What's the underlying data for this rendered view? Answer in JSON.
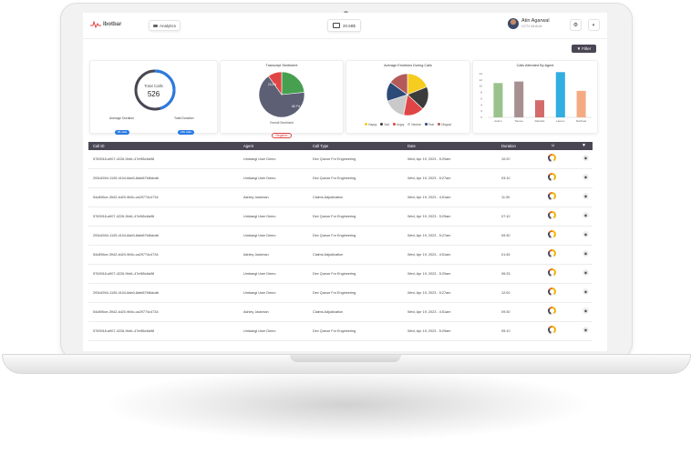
{
  "app": {
    "brand": "Ibotbar"
  },
  "header": {
    "section_label": "Analytics",
    "credits": "20.68$",
    "user_name": "Atin Agarwal",
    "user_sub": "CCTV 48 ALM",
    "filter_label": "Filter"
  },
  "cards": {
    "total_calls": {
      "label": "Total Calls",
      "value": "526",
      "avg_label": "Average Duration",
      "avg_value": "85 calls",
      "total_label": "Total Duration",
      "total_value": "180 calls"
    },
    "sentiment": {
      "title": "Transcript Sentiment",
      "slice_labels": [
        "23.4%",
        "66.7%"
      ],
      "overall_label": "Overall Sentiment",
      "overall_value": "Negative"
    },
    "emotions": {
      "title": "Average Emotions During Calls",
      "legend": [
        "Happy",
        "Sad",
        "Angry",
        "Neutral",
        "Fear",
        "Disgust"
      ]
    },
    "agent_calls": {
      "title": "Calls Attended By Agent",
      "y_ticks": [
        "14",
        "12",
        "10",
        "8",
        "6",
        "4",
        "2",
        "0"
      ],
      "agents": [
        "Action",
        "Tanvee",
        "Danielle",
        "Lauren",
        "Rachael"
      ]
    }
  },
  "chart_data": [
    {
      "type": "pie",
      "title": "Transcript Sentiment",
      "labels": [
        "Positive",
        "Negative",
        "Neutral"
      ],
      "values": [
        23.4,
        66.7,
        9.9
      ],
      "colors": [
        "#46a04f",
        "#5d5f74",
        "#e04545"
      ]
    },
    {
      "type": "pie",
      "title": "Average Emotions During Calls",
      "labels": [
        "Happy",
        "Sad",
        "Angry",
        "Neutral",
        "Fear",
        "Disgust"
      ],
      "values": [
        19,
        18,
        16,
        17,
        15,
        15
      ],
      "colors": [
        "#f5cc1f",
        "#3b3b3b",
        "#e04545",
        "#c9c9c9",
        "#2c4a78",
        "#b55a5a"
      ]
    },
    {
      "type": "bar",
      "title": "Calls Attended By Agent",
      "categories": [
        "Action",
        "Tanvee",
        "Danielle",
        "Lauren",
        "Rachael"
      ],
      "values": [
        11,
        11.5,
        5.5,
        14.5,
        8.5
      ],
      "colors": [
        "#9bc28c",
        "#a89090",
        "#d46b6b",
        "#32aee0",
        "#f4ab84"
      ],
      "ylim": [
        0,
        14
      ]
    }
  ],
  "table": {
    "columns": [
      "Call ID",
      "Agent",
      "Call Type",
      "Date",
      "Duration"
    ],
    "rows": [
      {
        "id": "5763918-a907-4226-9bb1-47ef65c6a98",
        "agent": "Umbangi User Demo",
        "type": "Dev Queue For Engineering",
        "date": "Wed, Apr 19, 2023 - 5:29am",
        "duration": "10:20"
      },
      {
        "id": "293d1594-1105-4104-8ab0-8afd67fd6dcdb",
        "agent": "Umbangi User Demo",
        "type": "Dev Queue For Engineering",
        "date": "Wed, Apr 19, 2023 - 5:27am",
        "duration": "03:10"
      },
      {
        "id": "54c896ce-3942-4d20-9b5c-ca29774c4734",
        "agent": "Ashley Jackman",
        "type": "Claims Adjudication",
        "date": "Wed, Apr 19, 2023 - 4:51am",
        "duration": "11:30"
      },
      {
        "id": "5763918-a907-4226-9bb1-47ef65c6a98",
        "agent": "Umbangi User Demo",
        "type": "Dev Queue For Engineering",
        "date": "Wed, Apr 19, 2023 - 5:29am",
        "duration": "07:10"
      },
      {
        "id": "293d1594-1105-4104-8ab0-8afd67fd6dcdb",
        "agent": "Umbangi User Demo",
        "type": "Dev Queue For Engineering",
        "date": "Wed, Apr 19, 2023 - 5:27am",
        "duration": "09:30"
      },
      {
        "id": "54c896ce-3942-4d20-9b5c-ca29774c4734",
        "agent": "Ashley Jackman",
        "type": "Claims Adjudication",
        "date": "Wed, Apr 19, 2023 - 4:51am",
        "duration": "01:45"
      },
      {
        "id": "5763918-a907-4226-9bb1-47ef65c6a98",
        "agent": "Umbangi User Demo",
        "type": "Dev Queue For Engineering",
        "date": "Wed, Apr 19, 2023 - 5:29am",
        "duration": "06:33"
      },
      {
        "id": "293d1594-1105-4104-8ab0-8afd67fd6dcdb",
        "agent": "Umbangi User Demo",
        "type": "Dev Queue For Engineering",
        "date": "Wed, Apr 19, 2023 - 5:27am",
        "duration": "12:00"
      },
      {
        "id": "54c896ce-3942-4d20-9b5c-ca29774c4734",
        "agent": "Ashley Jackman",
        "type": "Claims Adjudication",
        "date": "Wed, Apr 19, 2023 - 4:51am",
        "duration": "09:30"
      },
      {
        "id": "5763918-a907-4226-9bb1-47ef65c6a98",
        "agent": "Umbangi User Demo",
        "type": "Dev Queue For Engineering",
        "date": "Wed, Apr 19, 2023 - 5:29am",
        "duration": "05:10"
      }
    ]
  }
}
